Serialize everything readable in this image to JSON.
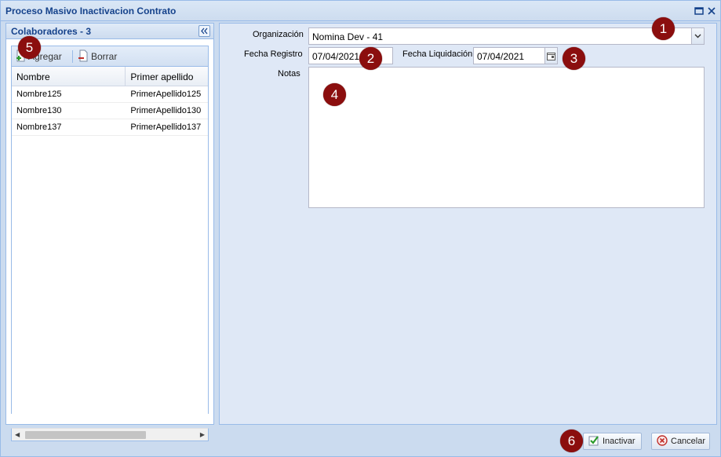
{
  "window": {
    "title": "Proceso Masivo Inactivacion Contrato"
  },
  "left_panel": {
    "title": "Colaboradores - 3",
    "toolbar": {
      "add_label": "Agregar",
      "delete_label": "Borrar"
    },
    "grid": {
      "columns": [
        "Nombre",
        "Primer apellido"
      ],
      "rows": [
        [
          "Nombre125",
          "PrimerApellido125"
        ],
        [
          "Nombre130",
          "PrimerApellido130"
        ],
        [
          "Nombre137",
          "PrimerApellido137"
        ]
      ]
    }
  },
  "form": {
    "organizacion_label": "Organización",
    "organizacion_value": "Nomina Dev - 41",
    "fecha_registro_label": "Fecha Registro",
    "fecha_registro_value": "07/04/2021",
    "fecha_liquidacion_label": "Fecha Liquidación",
    "fecha_liquidacion_value": "07/04/2021",
    "notas_label": "Notas",
    "notas_value": ""
  },
  "footer": {
    "inactivar_label": "Inactivar",
    "cancelar_label": "Cancelar"
  },
  "markers": [
    "1",
    "2",
    "3",
    "4",
    "5",
    "6"
  ],
  "colors": {
    "marker": "#8b0e0e",
    "title_text": "#15428b",
    "panel_bg": "#dfe8f6"
  }
}
